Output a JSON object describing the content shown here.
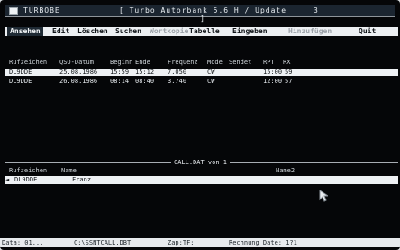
{
  "window": {
    "title": "TURBOBE",
    "app_title": "[ Turbo Autorbank 5.6 H / Update ]",
    "close_glyph": "3"
  },
  "menu": {
    "items": [
      {
        "label": "Ansehen"
      },
      {
        "label": "Edit"
      },
      {
        "label": "Löschen"
      },
      {
        "label": "Suchen"
      },
      {
        "label": "Wortkopie"
      },
      {
        "label": "Tabelle"
      },
      {
        "label": "Eingeben"
      },
      {
        "label": "Hinzufügen"
      },
      {
        "label": "Quit"
      }
    ]
  },
  "table": {
    "headers": [
      "Rufzeichen",
      "QSO-Datum",
      "Beginn",
      "Ende",
      "Frequenz",
      "Mode",
      "Sendet",
      "RPT",
      "RX"
    ],
    "rows": [
      [
        "DL9DDE",
        "25.08.1986",
        "15:59",
        "15:12",
        "7.050",
        "CW",
        "",
        "15:00",
        "59"
      ],
      [
        "DL9DDE",
        "26.08.1986",
        "08:14",
        "08:40",
        "3.740",
        "CW",
        "",
        "12:00",
        "57"
      ]
    ]
  },
  "panel": {
    "title": "CALL.DAT von 1",
    "headers": [
      "Rufzeichen",
      "Name",
      "Name2"
    ],
    "rows": [
      [
        "DL9DDE",
        "Franz"
      ]
    ]
  },
  "status": {
    "text": "Data: 01...",
    "path": "C:\\SSNTCALL.DBT",
    "zoom": "Zap:TF:",
    "hint": "Rechnung Date: 1?1"
  }
}
